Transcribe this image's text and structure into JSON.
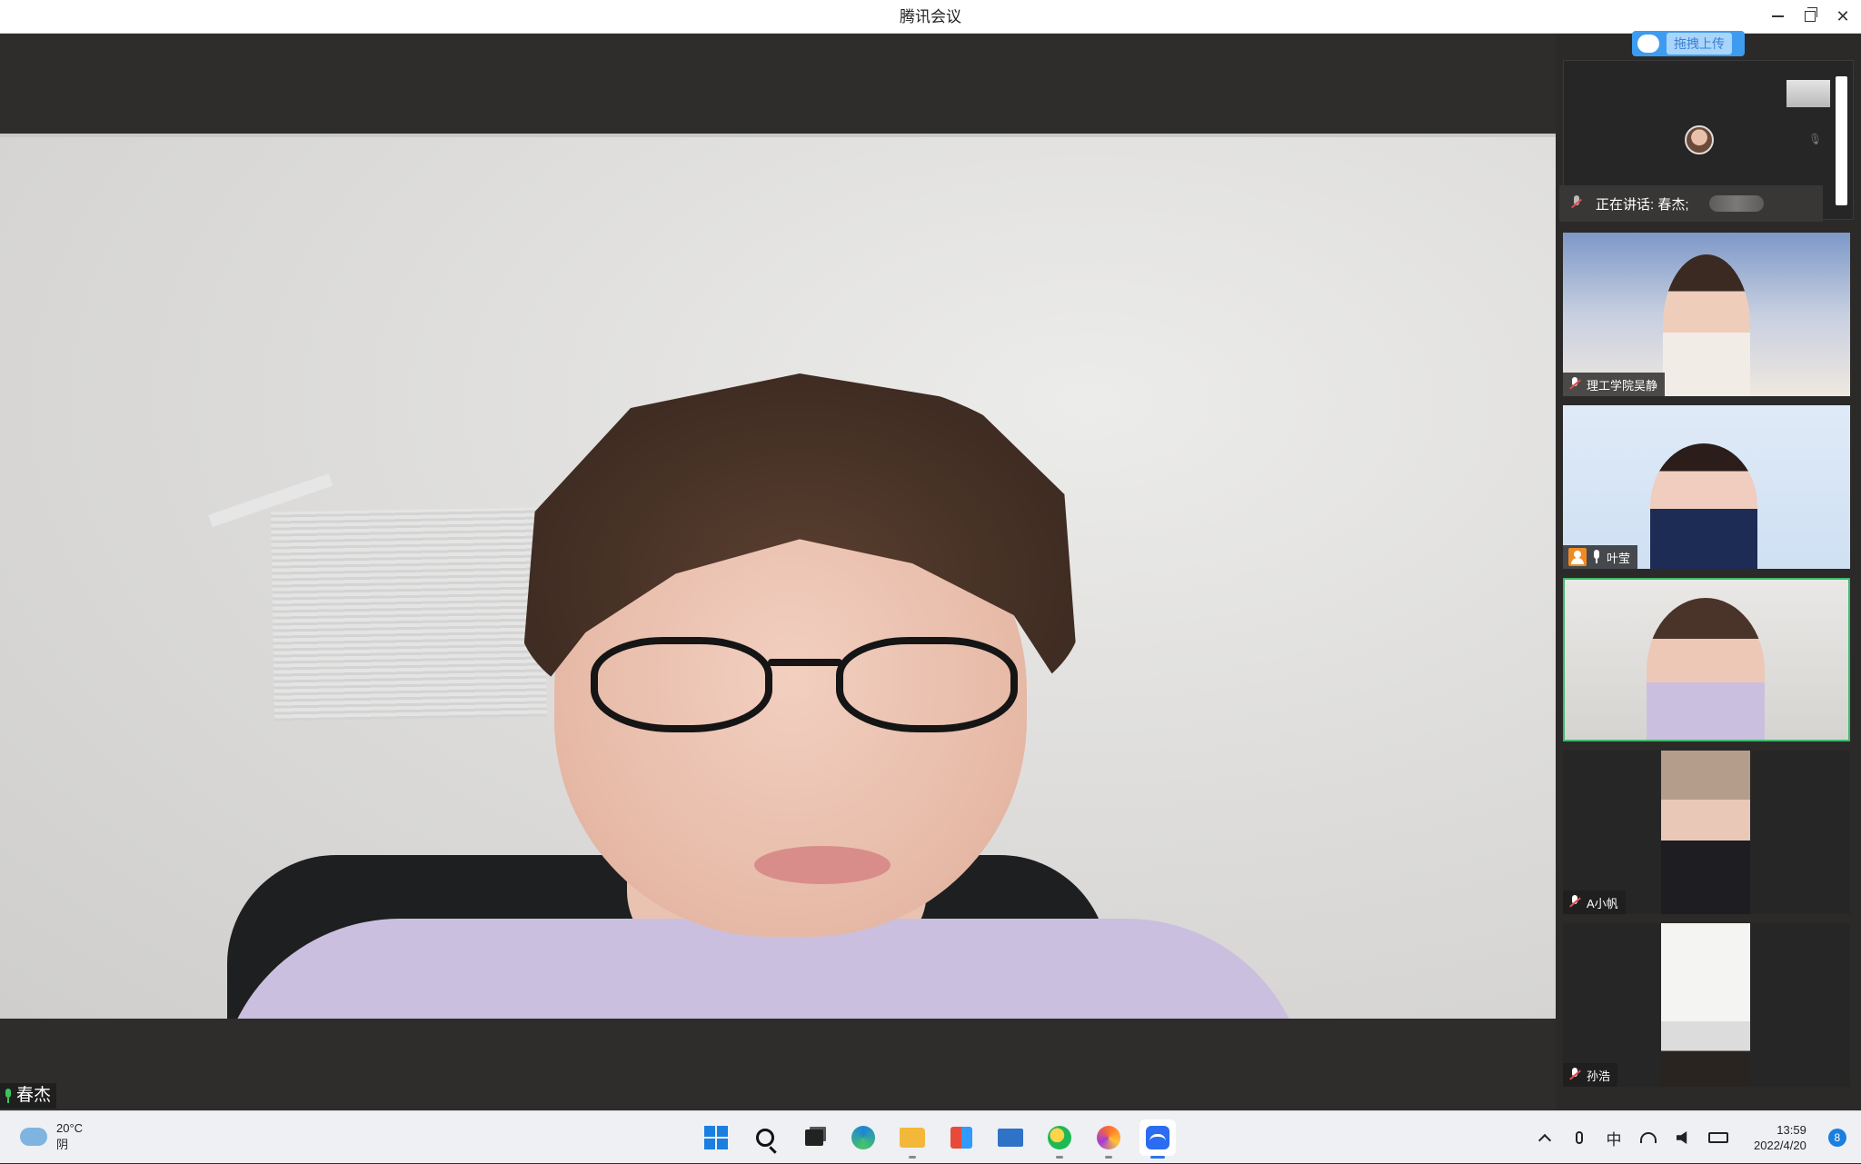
{
  "window": {
    "title": "腾讯会议"
  },
  "main_video": {
    "speaker_name": "春杰"
  },
  "side_panel": {
    "upload_label": "拖拽上传",
    "speaking_text": "正在讲话: 春杰;",
    "participants": [
      {
        "name": "理工学院吴静",
        "muted": true
      },
      {
        "name": "叶莹",
        "host": true,
        "muted": false
      },
      {
        "name": "",
        "active": true
      },
      {
        "name": "A小帆",
        "muted": true
      },
      {
        "name": "孙浩",
        "muted": true
      }
    ]
  },
  "taskbar": {
    "weather_temp": "20°C",
    "weather_desc": "阴",
    "ime": "中",
    "time": "13:59",
    "date": "2022/4/20",
    "notification_count": "8"
  },
  "colors": {
    "accent_blue": "#3d9cf0",
    "active_border": "#3dbb6c",
    "host_orange": "#f08a24"
  }
}
